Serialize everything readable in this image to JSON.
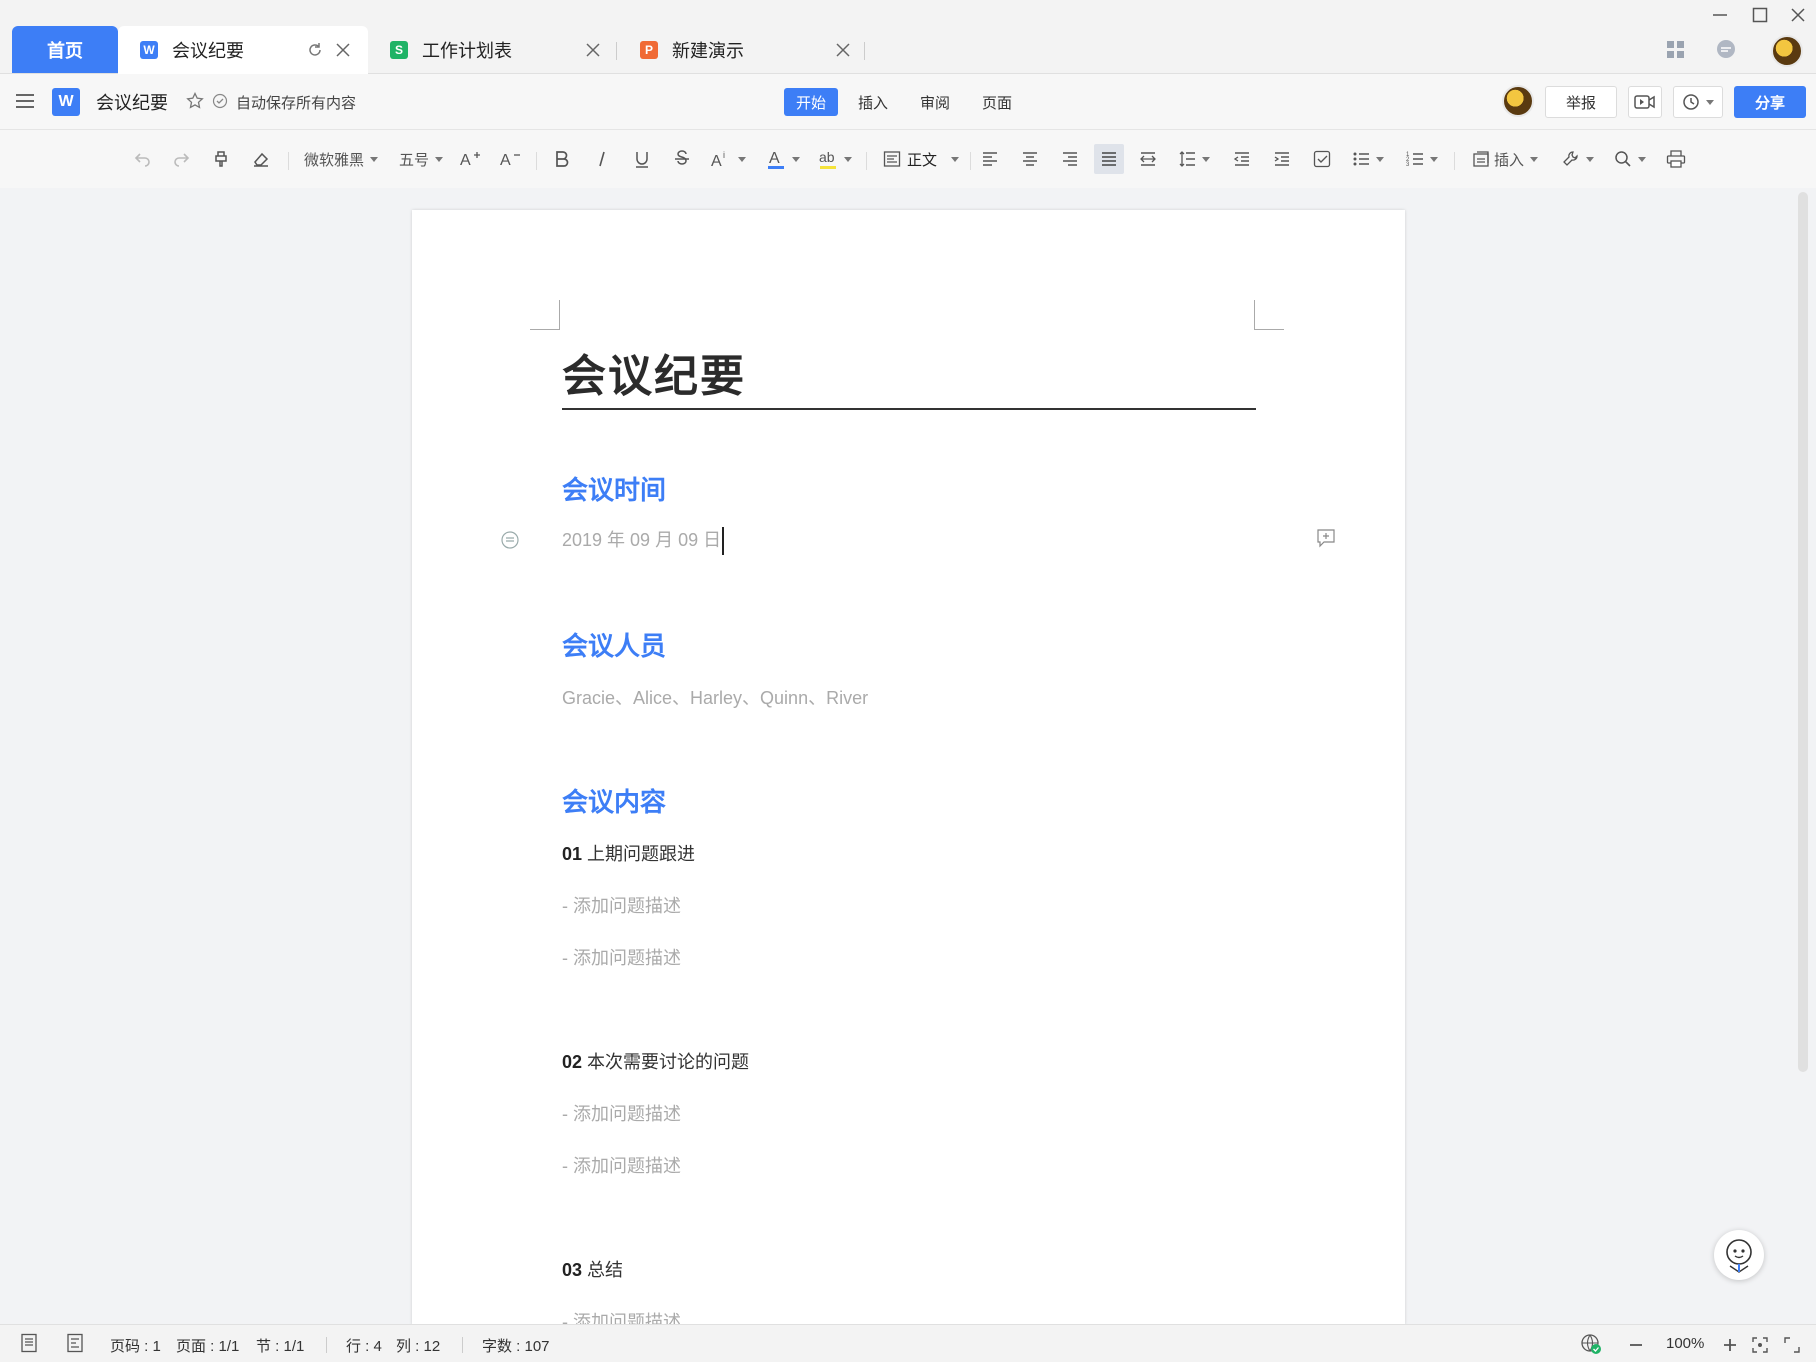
{
  "tabs": {
    "home_label": "首页",
    "items": [
      {
        "label": "会议纪要",
        "icon_letter": "W",
        "icon_color": "#3d7ef6"
      },
      {
        "label": "工作计划表",
        "icon_letter": "S",
        "icon_color": "#1fb366"
      },
      {
        "label": "新建演示",
        "icon_letter": "P",
        "icon_color": "#f06a35"
      }
    ]
  },
  "header": {
    "app_logo_letter": "W",
    "doc_title": "会议纪要",
    "autosave_text": "自动保存所有内容",
    "menu_tabs": [
      "开始",
      "插入",
      "审阅",
      "页面"
    ],
    "active_menu": "开始",
    "report_label": "举报",
    "share_label": "分享"
  },
  "toolbar": {
    "font_name": "微软雅黑",
    "font_size": "五号",
    "style_name": "正文",
    "insert_label": "插入",
    "icons": [
      "undo-icon",
      "redo-icon",
      "format-painter-icon",
      "eraser-icon",
      "font-grow-icon",
      "font-shrink-icon",
      "bold-icon",
      "italic-icon",
      "underline-icon",
      "strikethrough-icon",
      "superscript-icon",
      "font-color-icon",
      "highlight-icon",
      "align-left-icon",
      "align-center-icon",
      "align-right-icon",
      "justify-icon",
      "distributed-icon",
      "line-spacing-icon",
      "outdent-icon",
      "indent-icon",
      "checkbox-icon",
      "bullet-list-icon",
      "numbered-list-icon",
      "tools-icon",
      "search-icon",
      "print-icon"
    ]
  },
  "document": {
    "title": "会议纪要",
    "sections": [
      {
        "heading": "会议时间",
        "text": "2019 年 09 月 09 日"
      },
      {
        "heading": "会议人员",
        "text": "Gracie、Alice、Harley、Quinn、River"
      },
      {
        "heading": "会议内容"
      }
    ],
    "items": [
      {
        "num": "01",
        "title": "上期问题跟进",
        "bullets": [
          "-  添加问题描述",
          "-  添加问题描述"
        ]
      },
      {
        "num": "02",
        "title": "本次需要讨论的问题",
        "bullets": [
          "-  添加问题描述",
          "-  添加问题描述"
        ]
      },
      {
        "num": "03",
        "title": "总结",
        "bullets": [
          "-  添加问题描述"
        ]
      }
    ]
  },
  "status": {
    "page_code": "页码 : 1",
    "pages": "页面 : 1/1",
    "section": "节 : 1/1",
    "row": "行 : 4",
    "col": "列 : 12",
    "word_count": "字数 : 107",
    "zoom": "100%"
  }
}
